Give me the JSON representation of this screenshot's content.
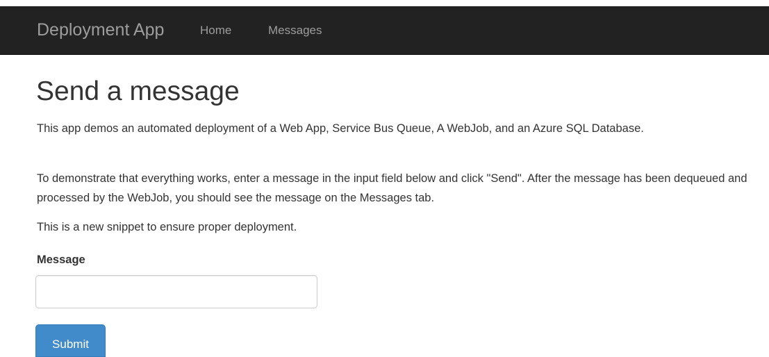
{
  "navbar": {
    "brand": "Deployment App",
    "links": [
      "Home",
      "Messages"
    ],
    "background_color": "#222222",
    "link_color": "#9d9d9d"
  },
  "main": {
    "title": "Send a message",
    "paragraphs": [
      "This app demos an automated deployment of a Web App, Service Bus Queue, A WebJob, and an Azure SQL Database.",
      "To demonstrate that everything works, enter a message in the input field below and click \"Send\". After the message has been dequeued and processed by the WebJob, you should see the message on the Messages tab.",
      "This is a new snippet to ensure proper deployment."
    ]
  },
  "form": {
    "message_label": "Message",
    "message_value": "",
    "submit_label": "Submit",
    "submit_color": "#428bca"
  }
}
